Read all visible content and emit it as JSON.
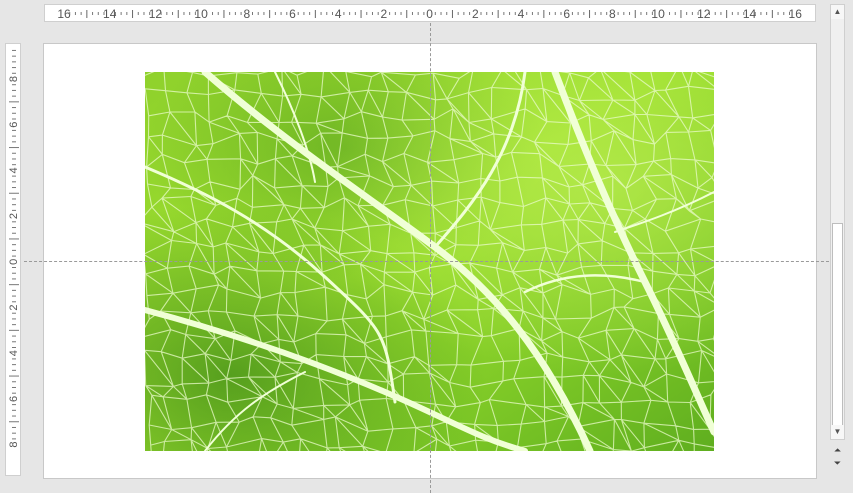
{
  "colors": {
    "workspace": "#e6e6e6",
    "slide": "#ffffff",
    "leaf_light": "#a6e33a",
    "leaf_mid": "#84cc2c",
    "leaf_dark": "#4f9a1c",
    "vein": "#f2ffd9"
  },
  "horizontal_ruler": {
    "labels": [
      "16",
      "14",
      "12",
      "10",
      "8",
      "6",
      "4",
      "2",
      "0",
      "2",
      "4",
      "6",
      "8",
      "10",
      "12",
      "14",
      "16"
    ]
  },
  "vertical_ruler": {
    "labels": [
      "8",
      "6",
      "4",
      "2",
      "0",
      "2",
      "4",
      "6",
      "8"
    ]
  },
  "slide": {
    "picture": {
      "subject": "leaf-macro-image"
    }
  },
  "scrollbar": {
    "up_icon": "triangle-up-icon",
    "down_icon": "triangle-down-icon",
    "prev_slide_icon": "double-chevron-up-icon",
    "next_slide_icon": "double-chevron-down-icon"
  }
}
